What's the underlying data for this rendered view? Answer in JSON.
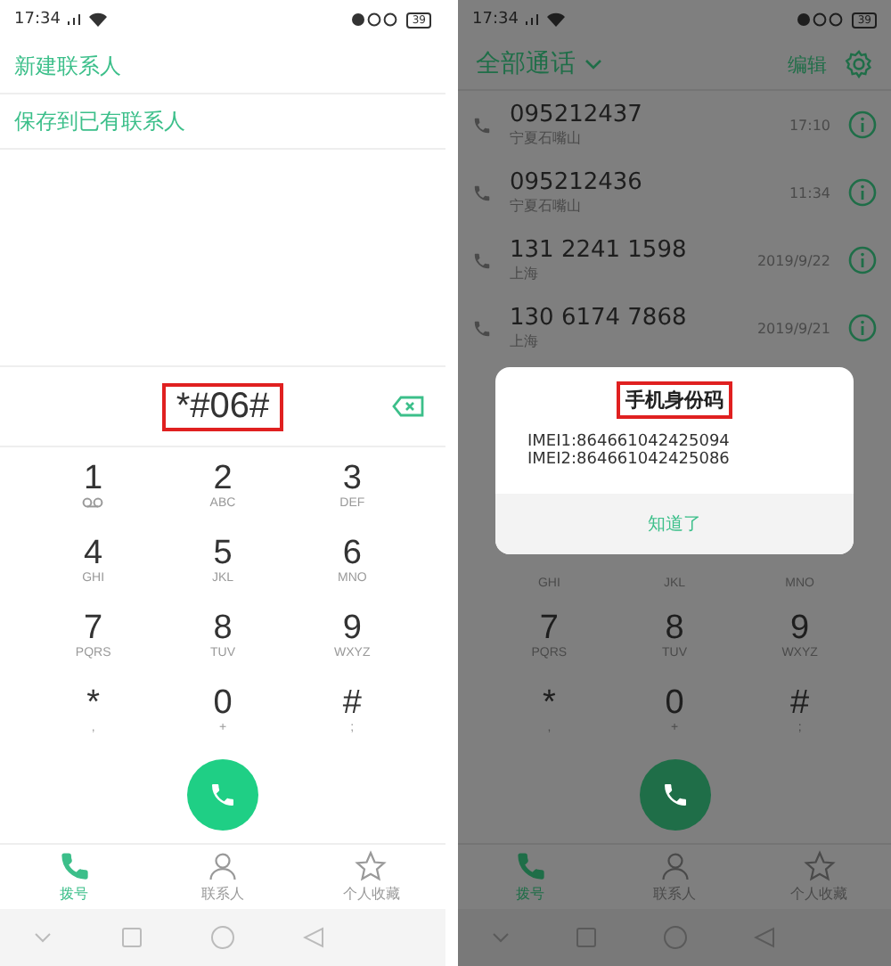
{
  "phones": [
    {
      "dimmed": false,
      "status_bar": {
        "time": "17:34",
        "battery": "39"
      },
      "menu": [
        "新建联系人",
        "保存到已有联系人"
      ],
      "number_display": {
        "value": "*#06#",
        "highlighted": true
      },
      "keypad": [
        [
          {
            "digit": "1",
            "kind": "voicemail"
          },
          {
            "digit": "2",
            "letters": "ABC"
          },
          {
            "digit": "3",
            "letters": "DEF"
          }
        ],
        [
          {
            "digit": "4",
            "letters": "GHI"
          },
          {
            "digit": "5",
            "letters": "JKL"
          },
          {
            "digit": "6",
            "letters": "MNO"
          }
        ],
        [
          {
            "digit": "7",
            "letters": "PQRS"
          },
          {
            "digit": "8",
            "letters": "TUV"
          },
          {
            "digit": "9",
            "letters": "WXYZ"
          }
        ],
        [
          {
            "digit": "*",
            "letters": ","
          },
          {
            "digit": "0",
            "letters": "+"
          },
          {
            "digit": "#",
            "letters": ";"
          }
        ]
      ],
      "tabs": [
        {
          "label": "拨号",
          "kind": "phone",
          "selected": true
        },
        {
          "label": "联系人",
          "kind": "person",
          "selected": false
        },
        {
          "label": "个人收藏",
          "kind": "star",
          "selected": false
        }
      ]
    },
    {
      "dimmed": true,
      "status_bar": {
        "time": "17:34",
        "battery": "39"
      },
      "header": {
        "title": "全部通话",
        "edit": "编辑"
      },
      "calls": [
        {
          "number": "095212437",
          "location": "宁夏石嘴山",
          "time": "17:10"
        },
        {
          "number": "095212436",
          "location": "宁夏石嘴山",
          "time": "11:34"
        },
        {
          "number": "131 2241 1598",
          "location": "上海",
          "time": "2019/9/22"
        },
        {
          "number": "130 6174 7868",
          "location": "上海",
          "time": "2019/9/21"
        }
      ],
      "dialog": {
        "title": "手机身份码",
        "highlighted": true,
        "lines": [
          "IMEI1:864661042425094",
          "IMEI2:864661042425086"
        ],
        "button": "知道了"
      },
      "keypad": [
        [
          {
            "letters": "GHI"
          },
          {
            "letters": "JKL"
          },
          {
            "letters": "MNO"
          }
        ],
        [
          {
            "digit": "7",
            "letters": "PQRS"
          },
          {
            "digit": "8",
            "letters": "TUV"
          },
          {
            "digit": "9",
            "letters": "WXYZ"
          }
        ],
        [
          {
            "digit": "*",
            "letters": ","
          },
          {
            "digit": "0",
            "letters": "+"
          },
          {
            "digit": "#",
            "letters": ";"
          }
        ]
      ],
      "tabs": [
        {
          "label": "拨号",
          "kind": "phone",
          "selected": true
        },
        {
          "label": "联系人",
          "kind": "person",
          "selected": false
        },
        {
          "label": "个人收藏",
          "kind": "star",
          "selected": false
        }
      ]
    }
  ]
}
